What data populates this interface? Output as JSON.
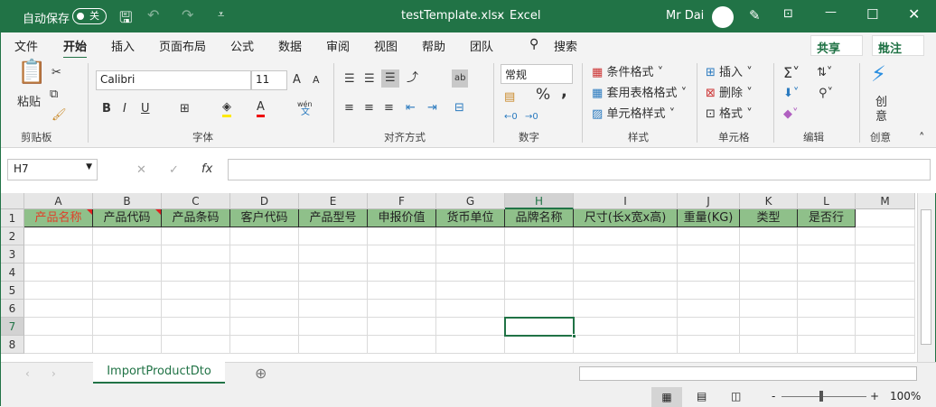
{
  "title": {
    "autosave": "自动保存",
    "autosave_state": "关",
    "filename": "testTemplate.xlsx",
    "separator": "-",
    "app": "Excel",
    "user": "Mr Dai"
  },
  "menu": {
    "tabs": [
      "文件",
      "开始",
      "插入",
      "页面布局",
      "公式",
      "数据",
      "审阅",
      "视图",
      "帮助",
      "团队"
    ],
    "active": "开始",
    "search": "搜索",
    "share": "共享",
    "comment": "批注"
  },
  "ribbon": {
    "clipboard": {
      "paste": "粘贴",
      "label": "剪贴板"
    },
    "font": {
      "name": "Calibri",
      "size": "11",
      "bold": "B",
      "italic": "I",
      "underline": "U",
      "phonetic": "wén",
      "phonetic2": "文",
      "label": "字体",
      "font_color": "A",
      "grow": "A",
      "shrink": "A"
    },
    "alignment": {
      "label": "对齐方式"
    },
    "number": {
      "format": "常规",
      "percent": "%",
      "comma": ",",
      "label": "数字"
    },
    "styles": {
      "conditional": "条件格式",
      "table": "套用表格格式",
      "cell_styles": "单元格样式",
      "label": "样式"
    },
    "cells": {
      "insert": "插入",
      "delete": "删除",
      "format": "格式",
      "label": "单元格"
    },
    "editing": {
      "label": "编辑"
    },
    "ideas": {
      "button": "创意",
      "label": "创意"
    }
  },
  "formula_bar": {
    "name_box": "H7",
    "fx": "fx",
    "value": ""
  },
  "sheet": {
    "columns": [
      "A",
      "B",
      "C",
      "D",
      "E",
      "F",
      "G",
      "H",
      "I",
      "J",
      "K",
      "L",
      "M"
    ],
    "rows": [
      "1",
      "2",
      "3",
      "4",
      "5",
      "6",
      "7",
      "8"
    ],
    "headers": [
      "产品名称",
      "产品代码",
      "产品条码",
      "客户代码",
      "产品型号",
      "申报价值",
      "货币单位",
      "品牌名称",
      "尺寸(长x宽x高)",
      "重量(KG)",
      "类型",
      "是否行"
    ],
    "selected_cell": "H7"
  },
  "sheet_tabs": {
    "active": "ImportProductDto"
  },
  "status": {
    "zoom": "100%",
    "minus": "-",
    "plus": "+"
  },
  "colors": {
    "brand": "#217346",
    "header_fill": "#8fc08a",
    "required_text": "#e0402a"
  }
}
